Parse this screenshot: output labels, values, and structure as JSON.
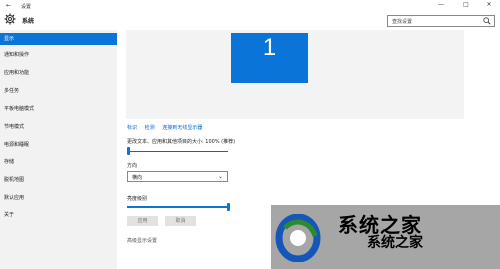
{
  "titlebar": {
    "back": "←",
    "title": "设置",
    "minimize": "—",
    "maximize": "□",
    "close": "✕"
  },
  "header": {
    "app_name": "系统",
    "search_placeholder": "查找设置"
  },
  "sidebar": {
    "items": [
      {
        "label": "显示",
        "active": true
      },
      {
        "label": "通知和操作"
      },
      {
        "label": "应用和功能"
      },
      {
        "label": "多任务"
      },
      {
        "label": "平板电脑模式"
      },
      {
        "label": "节电模式"
      },
      {
        "label": "电源和睡眠"
      },
      {
        "label": "存储"
      },
      {
        "label": "脱机地图"
      },
      {
        "label": "默认应用"
      },
      {
        "label": "关于"
      }
    ]
  },
  "main": {
    "monitor_number": "1",
    "links": [
      "标识",
      "检测",
      "连接到无线显示器"
    ],
    "scale_label": "更改文本、应用和其他项目的大小: 100% (推荐)",
    "scale_level": 0.0,
    "orientation_label": "方向",
    "orientation_value": "横向",
    "brightness_label": "亮度级别",
    "brightness_level": 1.0,
    "apply_button": "应用",
    "cancel_button": "取消",
    "advanced_link": "高级显示设置"
  },
  "watermark": {
    "big_text": "系统之家",
    "name_text": "系统之家"
  },
  "colors": {
    "accent": "#0a74d8",
    "sidebar_bg": "#f2f2f2"
  }
}
